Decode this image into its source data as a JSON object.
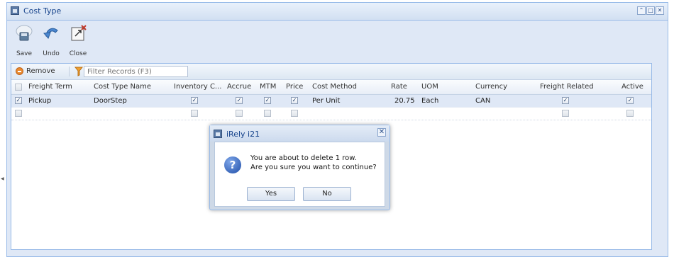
{
  "window": {
    "title": "Cost Type",
    "controls": [
      "restore",
      "maximize",
      "close"
    ]
  },
  "toolbar": {
    "save_label": "Save",
    "undo_label": "Undo",
    "close_label": "Close"
  },
  "grid_toolbar": {
    "remove_label": "Remove",
    "filter_placeholder": "Filter Records (F3)"
  },
  "grid": {
    "columns": [
      "Freight Term",
      "Cost Type Name",
      "Inventory C...",
      "Accrue",
      "MTM",
      "Price",
      "Cost Method",
      "Rate",
      "UOM",
      "Currency",
      "Freight Related",
      "Active"
    ],
    "rows": [
      {
        "selected": true,
        "freight_term": "Pickup",
        "cost_type_name": "DoorStep",
        "inventory_cost": true,
        "accrue": true,
        "mtm": true,
        "price": true,
        "cost_method": "Per Unit",
        "rate": "20.75",
        "uom": "Each",
        "currency": "CAN",
        "freight_related": true,
        "active": true
      },
      {
        "selected": false,
        "freight_term": "",
        "cost_type_name": "",
        "inventory_cost": false,
        "accrue": false,
        "mtm": false,
        "price": false,
        "cost_method": "",
        "rate": "",
        "uom": "",
        "currency": "",
        "freight_related": false,
        "active": false
      }
    ]
  },
  "dialog": {
    "title": "iRely i21",
    "message_line1": "You are about to delete 1 row.",
    "message_line2": "Are you sure you want to continue?",
    "yes_label": "Yes",
    "no_label": "No"
  },
  "colors": {
    "frame_border": "#99bbe8",
    "panel_bg": "#dfe8f6",
    "title_text": "#15428b",
    "selected_row": "#dfe8f6"
  },
  "icons": [
    "window-icon",
    "restore-icon",
    "maximize-icon",
    "close-icon",
    "save-icon",
    "undo-icon",
    "close-doc-icon",
    "remove-icon",
    "filter-icon",
    "question-icon"
  ]
}
